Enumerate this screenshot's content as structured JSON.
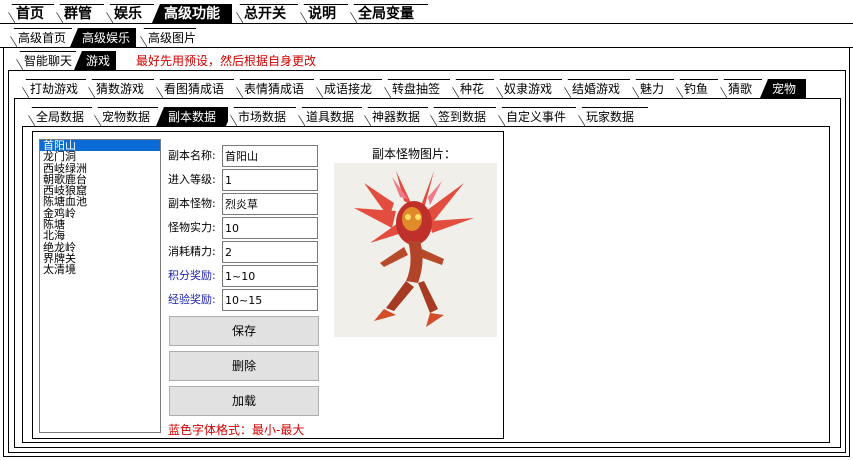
{
  "main_tabs": [
    "首页",
    "群管",
    "娱乐",
    "高级功能",
    "总开关",
    "说明",
    "全局变量"
  ],
  "advanced_tabs": [
    "高级首页",
    "高级娱乐",
    "高级图片"
  ],
  "sub_tabs": [
    "智能聊天",
    "游戏"
  ],
  "hint": "最好先用预设，然后根据自身更改",
  "game_tabs": [
    "打劫游戏",
    "猜数游戏",
    "看图猜成语",
    "表情猜成语",
    "成语接龙",
    "转盘抽签",
    "种花",
    "奴隶游戏",
    "结婚游戏",
    "魅力",
    "钓鱼",
    "猜歌",
    "宠物"
  ],
  "pet_tabs": [
    "全局数据",
    "宠物数据",
    "副本数据",
    "市场数据",
    "道具数据",
    "神器数据",
    "签到数据",
    "自定义事件",
    "玩家数据"
  ],
  "dungeon_list": [
    "首阳山",
    "龙门洞",
    "西岐绿洲",
    "朝歌鹿台",
    "西岐狼窟",
    "陈塘血池",
    "金鸡岭",
    "陈塘",
    "北海",
    "绝龙岭",
    "界牌关",
    "太清境"
  ],
  "fields": {
    "name": {
      "label": "副本名称:",
      "value": "首阳山"
    },
    "level": {
      "label": "进入等级:",
      "value": "1"
    },
    "monster": {
      "label": "副本怪物:",
      "value": "烈炎草"
    },
    "power": {
      "label": "怪物实力:",
      "value": "10"
    },
    "energy": {
      "label": "消耗精力:",
      "value": "2"
    },
    "points": {
      "label": "积分奖励:",
      "value": "1~10"
    },
    "exp": {
      "label": "经验奖励:",
      "value": "10~15"
    }
  },
  "buttons": {
    "save": "保存",
    "delete": "删除",
    "load": "加载"
  },
  "format_note": "蓝色字体格式：最小-最大",
  "monster_image_label": "副本怪物图片：",
  "colors": {
    "hint_red": "#d40000",
    "blue_label": "#1c22b0",
    "selection": "#0b6bd6"
  }
}
